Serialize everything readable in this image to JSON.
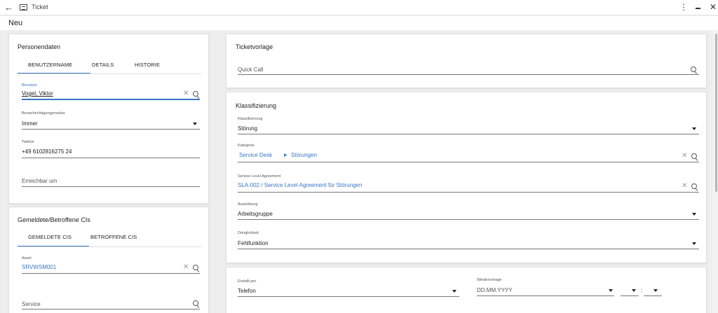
{
  "window": {
    "title": "Ticket"
  },
  "page": {
    "mode": "Neu"
  },
  "personendaten": {
    "title": "Personendaten",
    "tabs": [
      "BENUTZERNAME",
      "DETAILS",
      "HISTORIE"
    ],
    "benutzer": {
      "label": "Benutzer",
      "value": "Vogel, Viktor"
    },
    "benachrichtigung": {
      "label": "Benachrichtigungsmodus",
      "value": "Immer"
    },
    "telefon": {
      "label": "Telefon",
      "value": "+49 6102816275 24"
    },
    "erreichbar": {
      "placeholder": "Erreichbar um"
    }
  },
  "cis": {
    "title": "Gemeldete/Betroffene CIs",
    "tabs": [
      "GEMELDETE CIS",
      "BETROFFENE CIS"
    ],
    "asset": {
      "label": "Asset",
      "value": "SRVWSM001"
    },
    "service": {
      "placeholder": "Service"
    }
  },
  "ticketvorlage": {
    "title": "Ticketvorlage",
    "quick_call": {
      "placeholder": "Quick Call"
    }
  },
  "klassifizierung": {
    "title": "Klassifizierung",
    "klassifizierung": {
      "label": "Klassifizierung",
      "value": "Störung"
    },
    "kategorie": {
      "label": "Kategorie",
      "path": [
        "Service Desk",
        "Störungen"
      ]
    },
    "sla": {
      "label": "Service Level Agreement",
      "value": "SLA-002 / Service Level Agreement für Störungen"
    },
    "auswirkung": {
      "label": "Auswirkung",
      "value": "Arbeitsgruppe"
    },
    "dringlichkeit": {
      "label": "Dringlichkeit",
      "value": "Fehlfunktion"
    }
  },
  "erstellung": {
    "erstellt_per": {
      "label": "Erstellt per",
      "value": "Telefon"
    },
    "wiedervorlage": {
      "label": "Wiedervorlage",
      "placeholder": "DD.MM.YYYY",
      "time_separator": ":"
    }
  },
  "icons": [
    "back-arrow-icon",
    "ticket-icon",
    "more-vert-icon",
    "minimize-icon",
    "close-icon",
    "search-icon",
    "clear-icon",
    "dropdown-arrow-icon",
    "chevron-right-icon"
  ],
  "colors": {
    "accent": "#3a76c4",
    "background": "#eeeeee",
    "card": "#ffffff"
  }
}
